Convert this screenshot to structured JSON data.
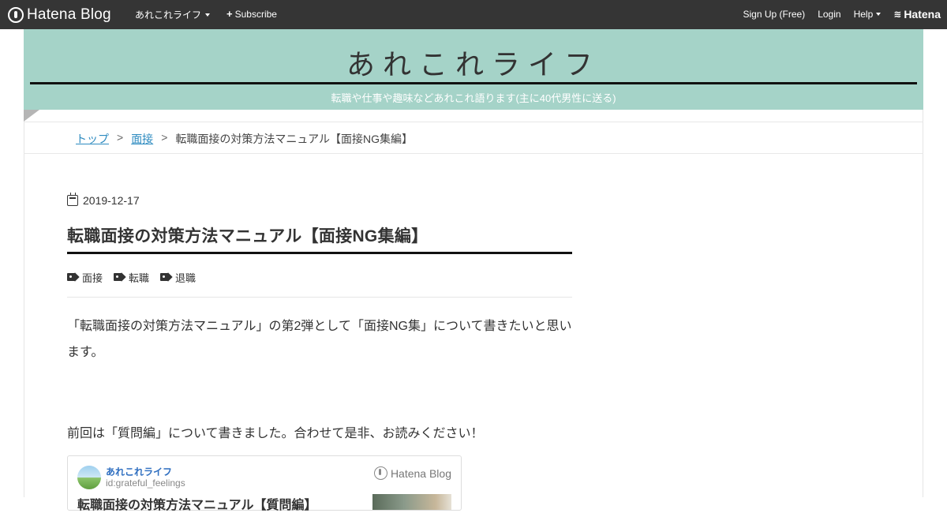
{
  "globalbar": {
    "brand": "Hatena Blog",
    "menu_label": "あれこれライフ",
    "subscribe_label": "Subscribe",
    "signup_label": "Sign Up (Free)",
    "login_label": "Login",
    "help_label": "Help",
    "hatena_label": "Hatena"
  },
  "header": {
    "title": "あれこれライフ",
    "description": "転職や仕事や趣味などあれこれ語ります(主に40代男性に送る)"
  },
  "breadcrumb": {
    "items": [
      "トップ",
      "面接",
      "転職面接の対策方法マニュアル【面接NG集編】"
    ],
    "separator": ">"
  },
  "article": {
    "date": "2019-12-17",
    "title": "転職面接の対策方法マニュアル【面接NG集編】",
    "tags": [
      "面接",
      "転職",
      "退職"
    ],
    "paragraph1": "「転職面接の対策方法マニュアル」の第2弾として「面接NG集」について書きたいと思います。",
    "paragraph2": "前回は「質問編」について書きました。合わせて是非、お読みください！"
  },
  "embed": {
    "blog_name": "あれこれライフ",
    "user_id": "id:grateful_feelings",
    "brand": "Hatena Blog",
    "title": "転職面接の対策方法マニュアル【質問編】"
  },
  "colors": {
    "header_bg": "#a5d3c8",
    "globalbar_bg": "#353535",
    "link": "#2e8bc0"
  }
}
